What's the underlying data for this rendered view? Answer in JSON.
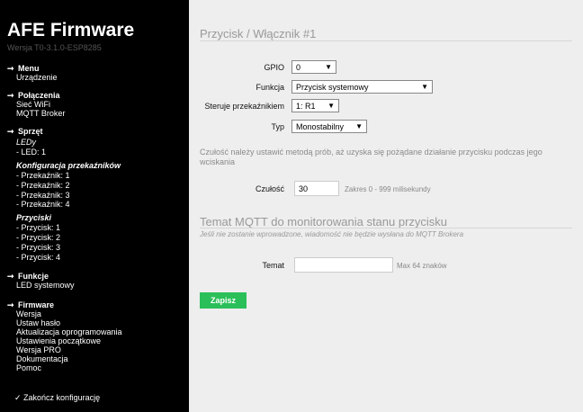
{
  "app": {
    "title": "AFE Firmware",
    "version": "Wersja T0-3.1.0-ESP8285"
  },
  "nav": {
    "arrow": "➞",
    "menu": {
      "label": "Menu",
      "items": [
        "Urządzenie"
      ]
    },
    "polaczenia": {
      "label": "Połączenia",
      "items": [
        "Sieć WiFi",
        "MQTT Broker"
      ]
    },
    "sprzet": {
      "label": "Sprzęt",
      "ledy": {
        "label": "LEDy",
        "items": [
          "- LED: 1"
        ]
      },
      "przekazniki": {
        "label": "Konfiguracja przekaźników",
        "items": [
          "- Przekaźnik: 1",
          "- Przekaźnik: 2",
          "- Przekaźnik: 3",
          "- Przekaźnik: 4"
        ]
      },
      "przyciski": {
        "label": "Przyciski",
        "items": [
          "- Przycisk: 1",
          "- Przycisk: 2",
          "- Przycisk: 3",
          "- Przycisk: 4"
        ]
      }
    },
    "funkcje": {
      "label": "Funkcje",
      "items": [
        "LED systemowy"
      ]
    },
    "firmware": {
      "label": "Firmware",
      "items": [
        "Wersja",
        "Ustaw hasło",
        "Aktualizacja oprogramowania",
        "Ustawienia początkowe",
        "Wersja PRO",
        "Dokumentacja",
        "Pomoc"
      ]
    },
    "exit": "✓ Zakończ konfigurację"
  },
  "form": {
    "heading": "Przycisk / Włącznik #1",
    "gpio": {
      "label": "GPIO",
      "value": "0"
    },
    "funkcja": {
      "label": "Funkcja",
      "value": "Przycisk systemowy"
    },
    "steruje": {
      "label": "Steruje przekaźnikiem",
      "value": "1: R1"
    },
    "typ": {
      "label": "Typ",
      "value": "Monostabilny"
    },
    "caret": "▼",
    "note": "Czułość należy ustawić metodą prób, aż uzyska się pożądane działanie przycisku podczas jego wciskania",
    "czulosc": {
      "label": "Czułość",
      "value": "30",
      "hint": "Zakres 0 - 999 milisekundy"
    },
    "mqtt": {
      "heading": "Temat MQTT do monitorowania stanu przycisku",
      "subheading": "Jeśli nie zostanie wprowadzone, wiadomość nie będzie wysłana do MQTT Brokera",
      "temat": {
        "label": "Temat",
        "value": "",
        "hint": "Max 64 znaków"
      }
    },
    "save_label": "Zapisz"
  },
  "colors": {
    "sidebar_bg": "#000000",
    "main_bg": "#eeeeee",
    "save_button": "#2bbf5a"
  }
}
